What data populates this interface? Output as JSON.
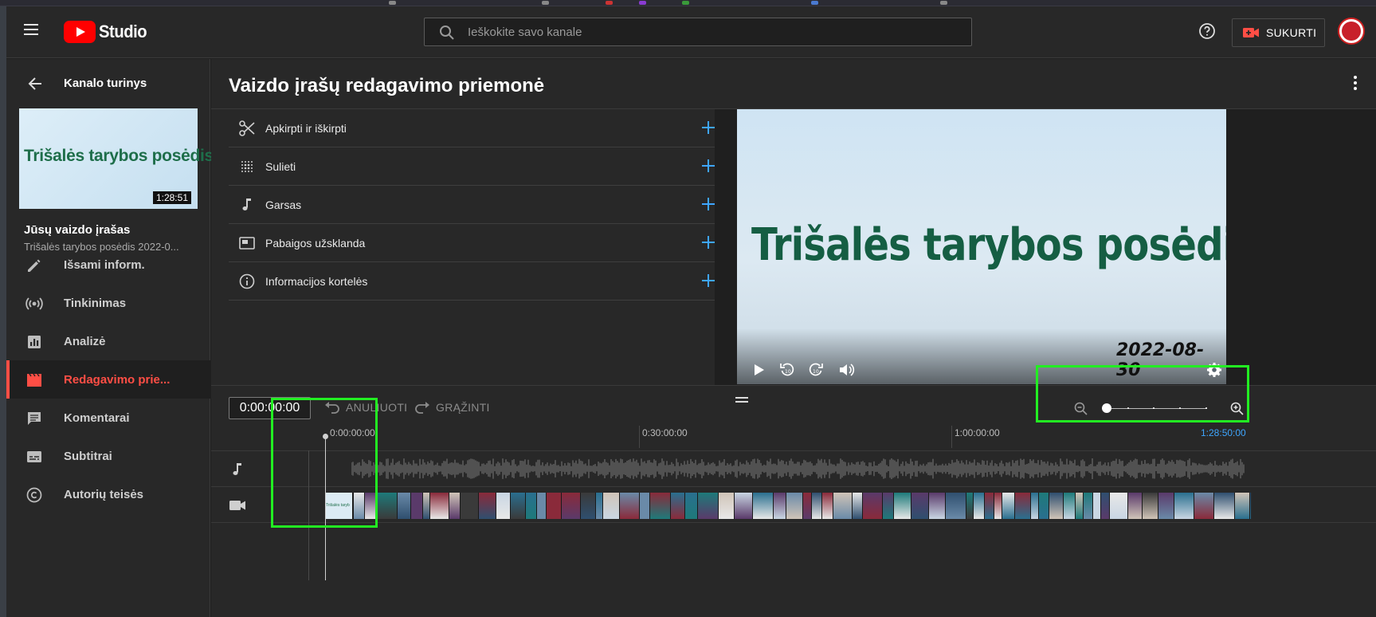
{
  "app": {
    "name": "Studio"
  },
  "search": {
    "placeholder": "Ieškokite savo kanale"
  },
  "header": {
    "create_label": "SUKURTI"
  },
  "sidebar": {
    "back_title": "Kanalo turinys",
    "thumbnail_text": "Trišalės tarybos posėdis",
    "thumbnail_duration": "1:28:51",
    "your_video_label": "Jūsų vaizdo įrašas",
    "video_title": "Trišalės tarybos posėdis 2022-0...",
    "items": [
      {
        "label": "Išsami inform.",
        "icon": "pencil-icon"
      },
      {
        "label": "Tinkinimas",
        "icon": "broadcast-icon"
      },
      {
        "label": "Analizė",
        "icon": "analytics-icon"
      },
      {
        "label": "Redagavimo prie...",
        "icon": "clapperboard-icon",
        "active": true
      },
      {
        "label": "Komentarai",
        "icon": "comment-icon"
      },
      {
        "label": "Subtitrai",
        "icon": "subtitles-icon"
      },
      {
        "label": "Autorių teisės",
        "icon": "copyright-icon"
      }
    ]
  },
  "main": {
    "title": "Vaizdo įrašų redagavimo priemonė",
    "tools": [
      {
        "label": "Apkirpti ir iškirpti",
        "icon": "scissors-icon"
      },
      {
        "label": "Sulieti",
        "icon": "blur-icon"
      },
      {
        "label": "Garsas",
        "icon": "music-note-icon"
      },
      {
        "label": "Pabaigos užsklanda",
        "icon": "end-screen-icon"
      },
      {
        "label": "Informacijos kortelės",
        "icon": "info-icon"
      }
    ]
  },
  "player": {
    "title_text": "Trišalės tarybos posėdis",
    "date_text": "2022-08-30"
  },
  "timeline": {
    "timecode": "0:00:00:00",
    "undo_label": "ANULIUOTI",
    "redo_label": "GRĄŽINTI",
    "zoom_level": 0,
    "ruler": [
      "0:00:00:00",
      "0:30:00:00",
      "1:00:00:00",
      "1:28:50:00"
    ],
    "film_title_text": "Trišalės taryb"
  },
  "colors": {
    "accent_red": "#ff4e45",
    "brand_red": "#ff0000",
    "add_blue": "#3ea6ff",
    "highlight_green": "#22ee22"
  }
}
